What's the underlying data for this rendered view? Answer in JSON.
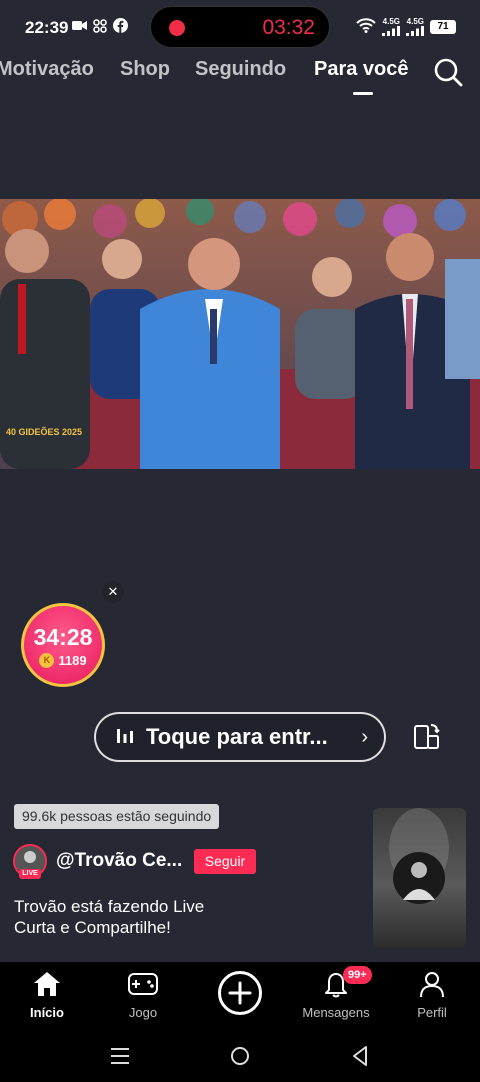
{
  "status_bar": {
    "time": "22:39",
    "recording_time": "03:32",
    "network_1": "4.5G",
    "network_2": "4.5G",
    "battery": "71"
  },
  "top_tabs": [
    {
      "label": "Motivação",
      "active": false
    },
    {
      "label": "Shop",
      "active": false
    },
    {
      "label": "Seguindo",
      "active": false
    },
    {
      "label": "Para você",
      "active": true
    }
  ],
  "video": {
    "logo_text": "40 GIDEÕES 2025"
  },
  "timer_badge": {
    "time": "34:28",
    "coin_symbol": "K",
    "coins": "1189"
  },
  "live_cta": {
    "label": "Toque para entr...",
    "chevron": "›"
  },
  "info": {
    "followers_text": "99.6k pessoas estão seguindo",
    "live_tag": "LIVE",
    "username": "@Trovão Ce...",
    "follow_label": "Seguir",
    "caption_line1": "Trovão está fazendo Live",
    "caption_line2": "Curta e Compartilhe!"
  },
  "bottom_nav": {
    "items": [
      {
        "label": "Início",
        "icon": "home-icon",
        "active": true
      },
      {
        "label": "Jogo",
        "icon": "gamepad-icon",
        "active": false
      },
      {
        "label": "",
        "icon": "plus-icon",
        "active": false
      },
      {
        "label": "Mensagens",
        "icon": "bell-icon",
        "active": false
      },
      {
        "label": "Perfil",
        "icon": "person-icon",
        "active": false
      }
    ],
    "messages_badge": "99+"
  },
  "colors": {
    "accent": "#fe2c55",
    "recording_red": "#f02e47",
    "background": "#262833"
  }
}
